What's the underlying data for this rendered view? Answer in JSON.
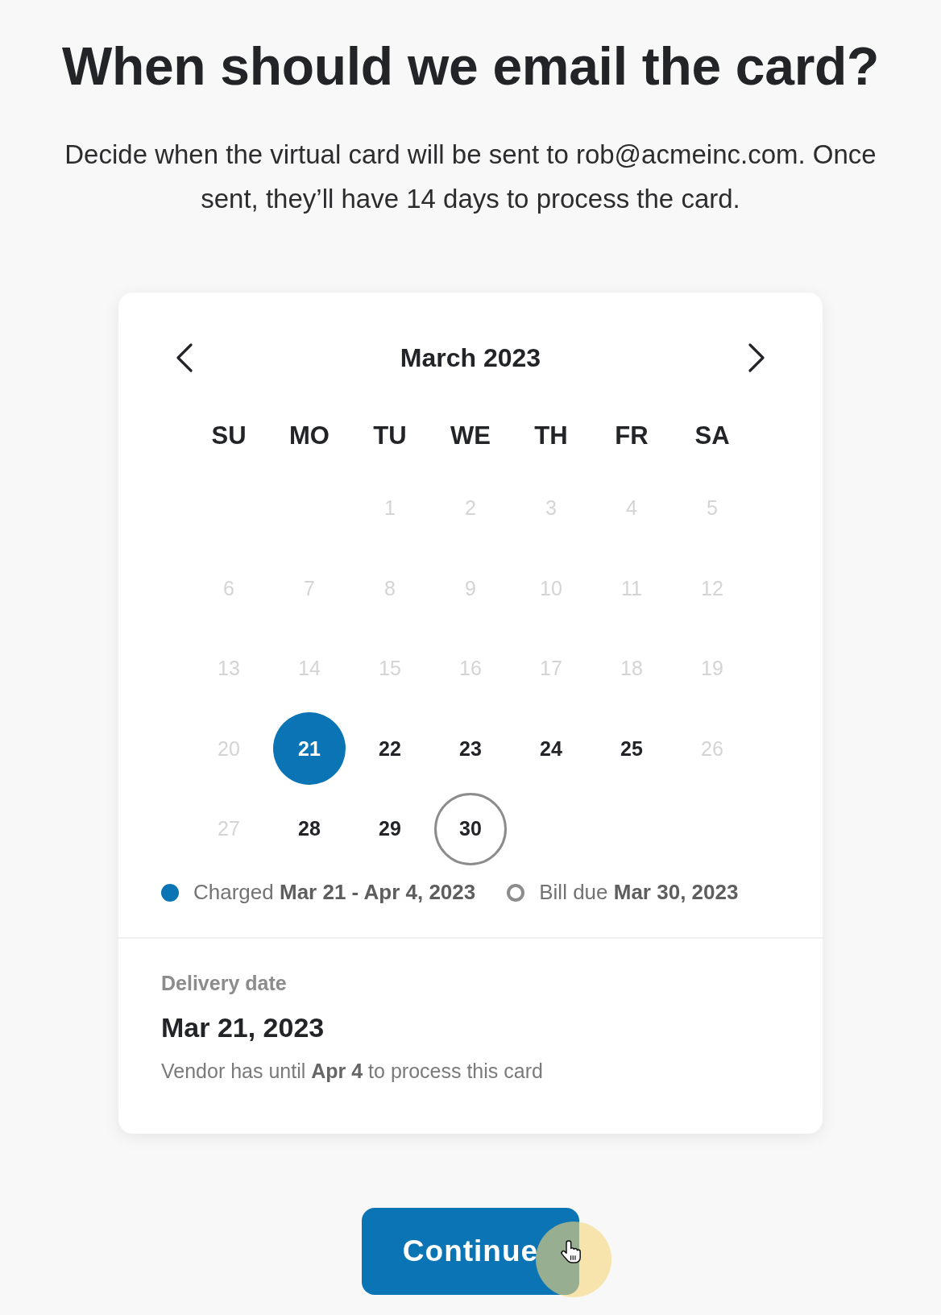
{
  "heading": {
    "title": "When should we email the card?",
    "description": "Decide when the virtual card will be sent to rob@acmeinc.com. Once sent, they’ll have 14 days to process the card."
  },
  "calendar": {
    "month": "March 2023",
    "weekdays": [
      "SU",
      "MO",
      "TU",
      "WE",
      "TH",
      "FR",
      "SA"
    ],
    "weeks": [
      [
        {
          "label": "1",
          "disabled": true,
          "selected": false,
          "bill_due": false
        },
        {
          "label": "2",
          "disabled": true,
          "selected": false,
          "bill_due": false
        },
        {
          "label": "3",
          "disabled": true,
          "selected": false,
          "bill_due": false
        },
        {
          "label": "4",
          "disabled": true,
          "selected": false,
          "bill_due": false
        },
        {
          "label": "5",
          "disabled": true,
          "selected": false,
          "bill_due": false
        }
      ],
      [
        {
          "label": "6",
          "disabled": true,
          "selected": false,
          "bill_due": false
        },
        {
          "label": "7",
          "disabled": true,
          "selected": false,
          "bill_due": false
        },
        {
          "label": "8",
          "disabled": true,
          "selected": false,
          "bill_due": false
        },
        {
          "label": "9",
          "disabled": true,
          "selected": false,
          "bill_due": false
        },
        {
          "label": "10",
          "disabled": true,
          "selected": false,
          "bill_due": false
        },
        {
          "label": "11",
          "disabled": true,
          "selected": false,
          "bill_due": false
        },
        {
          "label": "12",
          "disabled": true,
          "selected": false,
          "bill_due": false
        }
      ],
      [
        {
          "label": "13",
          "disabled": true,
          "selected": false,
          "bill_due": false
        },
        {
          "label": "14",
          "disabled": true,
          "selected": false,
          "bill_due": false
        },
        {
          "label": "15",
          "disabled": true,
          "selected": false,
          "bill_due": false
        },
        {
          "label": "16",
          "disabled": true,
          "selected": false,
          "bill_due": false
        },
        {
          "label": "17",
          "disabled": true,
          "selected": false,
          "bill_due": false
        },
        {
          "label": "18",
          "disabled": true,
          "selected": false,
          "bill_due": false
        },
        {
          "label": "19",
          "disabled": true,
          "selected": false,
          "bill_due": false
        }
      ],
      [
        {
          "label": "20",
          "disabled": true,
          "selected": false,
          "bill_due": false
        },
        {
          "label": "21",
          "disabled": false,
          "selected": true,
          "bill_due": false
        },
        {
          "label": "22",
          "disabled": false,
          "selected": false,
          "bill_due": false
        },
        {
          "label": "23",
          "disabled": false,
          "selected": false,
          "bill_due": false
        },
        {
          "label": "24",
          "disabled": false,
          "selected": false,
          "bill_due": false
        },
        {
          "label": "25",
          "disabled": false,
          "selected": false,
          "bill_due": false
        },
        {
          "label": "26",
          "disabled": true,
          "selected": false,
          "bill_due": false
        }
      ],
      [
        {
          "label": "27",
          "disabled": true,
          "selected": false,
          "bill_due": false
        },
        {
          "label": "28",
          "disabled": false,
          "selected": false,
          "bill_due": false
        },
        {
          "label": "29",
          "disabled": false,
          "selected": false,
          "bill_due": false
        },
        {
          "label": "30",
          "disabled": false,
          "selected": false,
          "bill_due": true
        }
      ]
    ],
    "legend": [
      {
        "kind": "dot",
        "color": "#0a74b4",
        "text": "Charged **Mar 21 - Apr 4, 2023**"
      },
      {
        "kind": "ring",
        "color": "#8c8c8c",
        "text": "Bill due **Mar 30, 2023**"
      }
    ]
  },
  "delivery": {
    "label": "Delivery date",
    "date": "Mar 21, 2023",
    "note": "Vendor has until **Apr 4** to process this card"
  },
  "continue_button": {
    "label": "Continue"
  }
}
